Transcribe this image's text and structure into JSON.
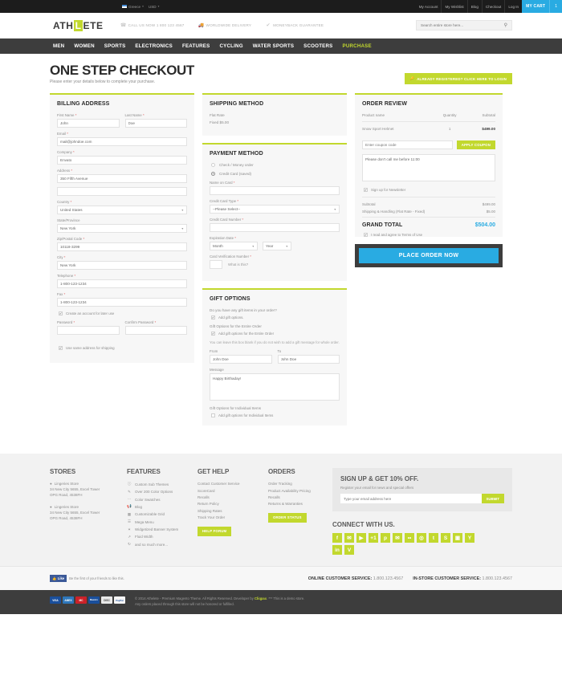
{
  "topbar": {
    "language": "Greece",
    "currency": "USD",
    "links": [
      "My Account",
      "My Wishlist",
      "Blog",
      "Checkout",
      "Log In"
    ],
    "cart_label": "MY CART",
    "cart_count": "1"
  },
  "header": {
    "logo_before": "ATH",
    "logo_box": "L",
    "logo_after": "ETE",
    "info": [
      {
        "icon": "phone-icon",
        "text": "CALL US NOW 1 800 123 4567"
      },
      {
        "icon": "truck-icon",
        "text": "WORLDWIDE DELIVERY"
      },
      {
        "icon": "shield-icon",
        "text": "MONEYBACK GUARANTEE"
      }
    ],
    "search_placeholder": "Search entire store here..."
  },
  "nav": {
    "items": [
      "MEN",
      "WOMEN",
      "SPORTS",
      "ELECTRONICS",
      "FEATURES",
      "CYCLING",
      "WATER SPORTS",
      "SCOOTERS",
      "PURCHASE"
    ],
    "active": "PURCHASE"
  },
  "page": {
    "title": "ONE STEP CHECKOUT",
    "subtitle": "Please enter your details below to complete your purchase.",
    "login_button": "ALREADY REGISTERED? CLICK HERE TO LOGIN"
  },
  "billing": {
    "heading": "BILLING ADDRESS",
    "first_name_label": "First Name",
    "first_name_value": "John",
    "last_name_label": "Last Name",
    "last_name_value": "Doe",
    "email_label": "Email",
    "email_value": "mail@johndoe.com",
    "company_label": "Company",
    "company_value": "Envato",
    "address_label": "Address",
    "address_value": "350 Fifth Avenue",
    "address2_value": "",
    "country_label": "Country",
    "country_value": "United States",
    "state_label": "State/Province",
    "state_value": "New York",
    "zip_label": "Zip/Postal Code",
    "zip_value": "10118-3299",
    "city_label": "City",
    "city_value": "New York",
    "telephone_label": "Telephone",
    "telephone_value": "1-800-123-1234",
    "fax_label": "Fax",
    "fax_value": "1-800-123-1234",
    "create_account_label": "Create an account for later use",
    "password_label": "Password",
    "password_value": "",
    "confirm_password_label": "Confirm Password",
    "confirm_password_value": "",
    "same_address_label": "Use same address for shipping"
  },
  "shipping": {
    "heading": "SHIPPING METHOD",
    "method": "Flat Rate",
    "price": "Fixed $5.00"
  },
  "payment": {
    "heading": "PAYMENT METHOD",
    "option_check": "Check / Money order",
    "option_card": "Credit Card (saved)",
    "name_on_card_label": "Name on Card",
    "name_on_card_value": "",
    "card_type_label": "Credit Card Type",
    "card_type_value": "--Please Select--",
    "card_number_label": "Credit Card Number",
    "card_number_value": "",
    "expiration_label": "Expiration Date",
    "expiration_month": "Month",
    "expiration_year": "Year",
    "cvv_label": "Card Verification Number",
    "cvv_value": "",
    "cvv_help": "What is this?"
  },
  "gift": {
    "heading": "GIFT OPTIONS",
    "question": "Do you have any gift items in your order?",
    "add_gift_label": "Add gift options.",
    "entire_order_title": "Gift Options for the Entire Order",
    "entire_order_label": "Add gift options for the Entire Order",
    "blank_note": "You can leave this box blank if you do not wish to add a gift message for whole order.",
    "from_label": "From",
    "from_value": "John Doe",
    "to_label": "To",
    "to_value": "John Doe",
    "message_label": "Message",
    "message_value": "Happy Birthaday!",
    "individual_title": "Gift Options for Individual Items",
    "individual_label": "Add gift options for Individual Items"
  },
  "order_review": {
    "heading": "ORDER REVIEW",
    "columns": [
      "Product name",
      "Quantity",
      "Subtotal"
    ],
    "items": [
      {
        "name": "Snow Sport Helmet",
        "qty": "1",
        "subtotal": "$499.00"
      }
    ],
    "coupon_placeholder": "Enter coupon code",
    "coupon_value": "",
    "apply_button": "APPLY COUPON",
    "comment_value": "Please don't call me before 11:00",
    "newsletter_label": "Sign up for Newsletter",
    "subtotal_label": "Subtotal",
    "subtotal_value": "$499.00",
    "shipping_label": "Shipping & Handling (Flat Rate - Fixed)",
    "shipping_value": "$5.00",
    "grand_total_label": "GRAND TOTAL",
    "grand_total_value": "$504.00",
    "terms_label": "I read and agree to Terms of Use",
    "place_order_button": "PLACE ORDER NOW"
  },
  "footer": {
    "stores": {
      "heading": "STORES",
      "list": [
        {
          "name": "Lingeries Store",
          "line1": "34 New City 5655, Excel Tower",
          "line2": "OPG Road, 4538FH"
        },
        {
          "name": "Lingeries Store",
          "line1": "34 New City 5655, Excel Tower",
          "line2": "OPG Road, 4538FH"
        }
      ]
    },
    "features": {
      "heading": "FEATURES",
      "items": [
        {
          "icon": "info-icon",
          "label": "Custom Sub Themes"
        },
        {
          "icon": "brush-icon",
          "label": "Over 200 Color Options"
        },
        {
          "icon": "swatch-icon",
          "label": "Color Swatches"
        },
        {
          "icon": "megaphone-icon",
          "label": "Blog"
        },
        {
          "icon": "grid-icon",
          "label": "Customizable Grid"
        },
        {
          "icon": "menu-icon",
          "label": "Mega Menu"
        },
        {
          "icon": "star-icon",
          "label": "Widgetized Banner System"
        },
        {
          "icon": "resize-icon",
          "label": "Fluid Width"
        },
        {
          "icon": "refresh-icon",
          "label": "and so much more..."
        }
      ]
    },
    "help": {
      "heading": "GET HELP",
      "items": [
        "Contact Customer Service",
        "ScoreCard",
        "Recalls",
        "Return Policy",
        "Shipping Rates",
        "Track Your Order"
      ],
      "button": "HELP FORUM"
    },
    "orders": {
      "heading": "ORDERS",
      "items": [
        "Order Tracking",
        "Product Availability Pricing",
        "Recalls",
        "Returns & Warranties"
      ],
      "button": "ORDER STATUS"
    },
    "signup": {
      "heading": "SIGN UP & GET 10% OFF.",
      "subtitle": "Register your email for news and special offers",
      "placeholder": "Type your email address here",
      "button": "SUBMIT"
    },
    "connect": {
      "heading": "CONNECT WITH US.",
      "socials": [
        {
          "name": "facebook-icon",
          "glyph": "f"
        },
        {
          "name": "twitter-icon",
          "glyph": "✉"
        },
        {
          "name": "youtube-icon",
          "glyph": "▶"
        },
        {
          "name": "googleplus-icon",
          "glyph": "+1"
        },
        {
          "name": "pinterest-icon",
          "glyph": "p"
        },
        {
          "name": "email-icon",
          "glyph": "✉"
        },
        {
          "name": "flickr-icon",
          "glyph": "••"
        },
        {
          "name": "dribbble-icon",
          "glyph": "◎"
        },
        {
          "name": "tumblr-icon",
          "glyph": "t"
        },
        {
          "name": "skype-icon",
          "glyph": "S"
        },
        {
          "name": "instagram-icon",
          "glyph": "▣"
        },
        {
          "name": "yahoo-icon",
          "glyph": "Y"
        },
        {
          "name": "linkedin-icon",
          "glyph": "in"
        },
        {
          "name": "vimeo-icon",
          "glyph": "V"
        }
      ]
    },
    "facebook_like": {
      "button": "Like",
      "text": "Be the first of your friends to like this."
    },
    "customer_service": [
      {
        "label": "ONLINE CUSTOMER SERVICE:",
        "value": "1.800.123.4567"
      },
      {
        "label": "IN-STORE CUSTOMER SERVICE:",
        "value": "1.800.123.4567"
      }
    ],
    "payment_icons": [
      {
        "name": "visa-icon",
        "label": "VISA",
        "color": "#1a4f9c"
      },
      {
        "name": "amex-icon",
        "label": "AMEX",
        "color": "#2e77bb"
      },
      {
        "name": "mastercard-icon",
        "label": "MC",
        "color": "#cc2229"
      },
      {
        "name": "maestro-icon",
        "label": "Maestro",
        "color": "#1a4f9c"
      },
      {
        "name": "discover-icon",
        "label": "DISC",
        "color": "#e8e8e8"
      },
      {
        "name": "paypal-icon",
        "label": "PayPal",
        "color": "#f5f5f5"
      }
    ],
    "copyright_line1": "© 2014 Athelete - Premium Magento Theme. All Rights Reserved. Developer by",
    "copyright_brand": "Cliqpax",
    "copyright_line1b": ". *** This is a demo store.",
    "copyright_line2": "Any orders placed through this store will not be honored or fulfilled."
  },
  "colors": {
    "accent_green": "#c2d82e",
    "accent_blue": "#29abe2",
    "dark": "#3d3d3d"
  }
}
